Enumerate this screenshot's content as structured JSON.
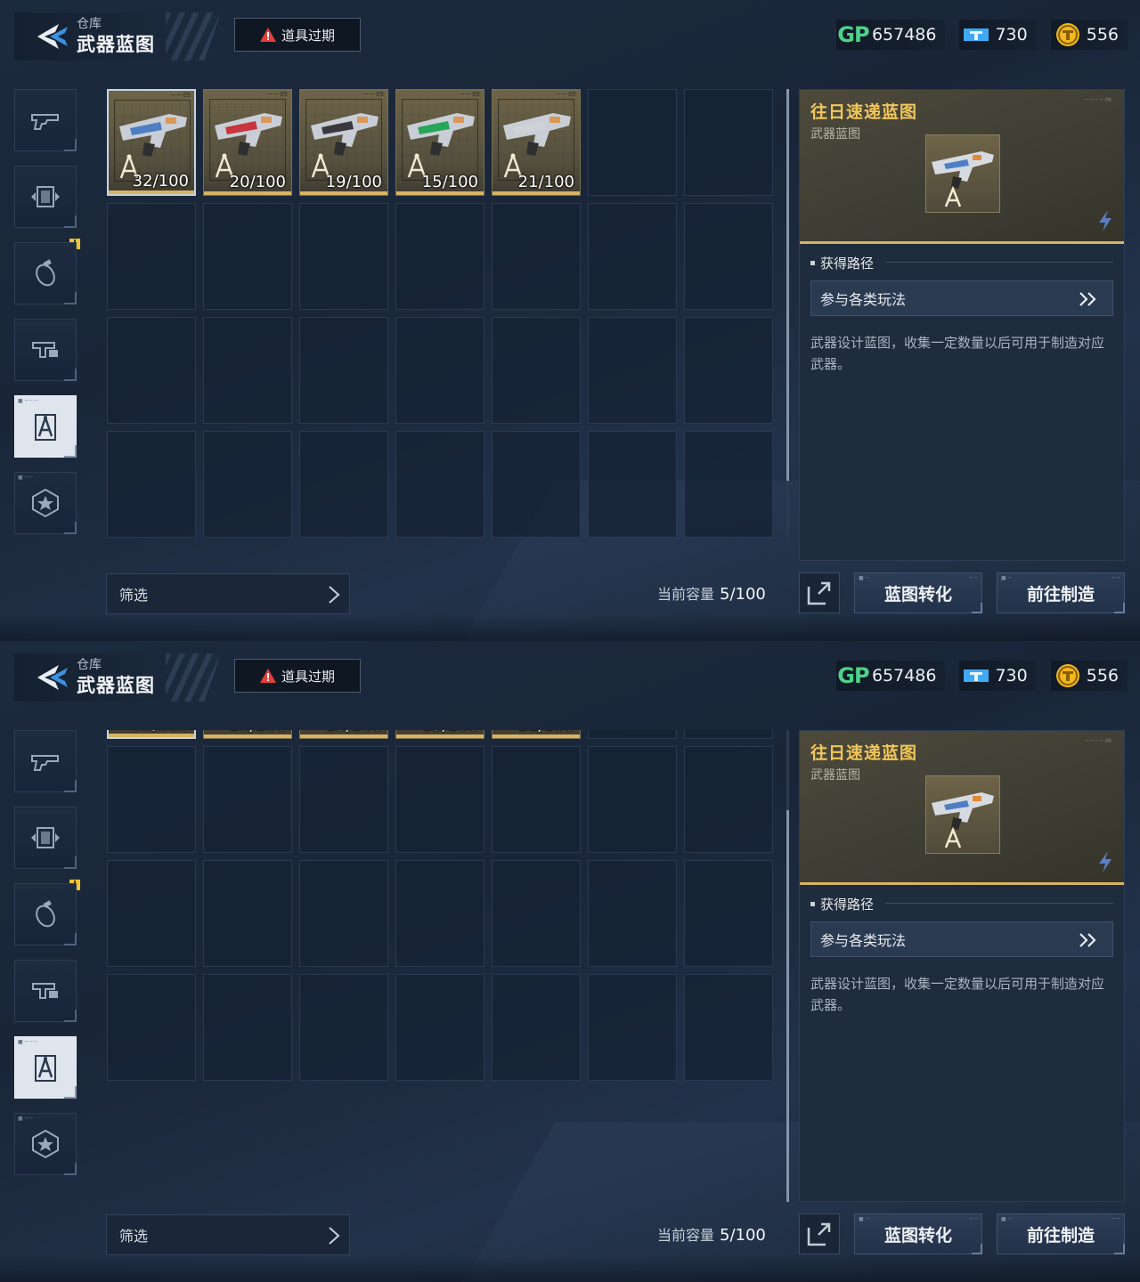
{
  "header": {
    "breadcrumb": "仓库",
    "title": "武器蓝图",
    "expired_label": "道具过期"
  },
  "currencies": {
    "gp_label": "GP",
    "gp": "657486",
    "ticket": "730",
    "coin": "556",
    "colors": {
      "gp": "#4fd18a",
      "ticket": "#3fa9f5",
      "coin": "#f1b81c"
    }
  },
  "sidebar": {
    "tabs": [
      {
        "icon": "pistol-icon",
        "active": false,
        "badge": ""
      },
      {
        "icon": "frame-icon",
        "active": false,
        "badge": ""
      },
      {
        "icon": "grenade-icon",
        "active": false,
        "badge": "!"
      },
      {
        "icon": "gun-part-icon",
        "active": false,
        "badge": ""
      },
      {
        "icon": "blueprint-compass-icon",
        "active": true,
        "badge": ""
      },
      {
        "icon": "star-badge-icon",
        "active": false,
        "badge": ""
      }
    ]
  },
  "inventory": {
    "items": [
      {
        "count": "32/100",
        "color": "#4f7ec4",
        "selected": true
      },
      {
        "count": "20/100",
        "color": "#c8353c",
        "selected": false
      },
      {
        "count": "19/100",
        "color": "#3a3a3e",
        "selected": false
      },
      {
        "count": "15/100",
        "color": "#27a65a",
        "selected": false
      },
      {
        "count": "21/100",
        "color": "#cfd3d8",
        "selected": false
      }
    ],
    "empty_slots": 23,
    "filter_label": "筛选",
    "capacity_label": "当前容量",
    "capacity_value": "5/100"
  },
  "detail": {
    "name": "往日速递蓝图",
    "type": "武器蓝图",
    "section_title": "获得路径",
    "route": "参与各类玩法",
    "description": "武器设计蓝图，收集一定数量以后可用于制造对应武器。"
  },
  "actions": {
    "convert": "蓝图转化",
    "craft": "前往制造"
  },
  "scroll_states": {
    "top_screen": 0.0,
    "bottom_screen": 0.23
  },
  "accent": {
    "gold": "#d6b463",
    "name": "#f1c65a"
  }
}
